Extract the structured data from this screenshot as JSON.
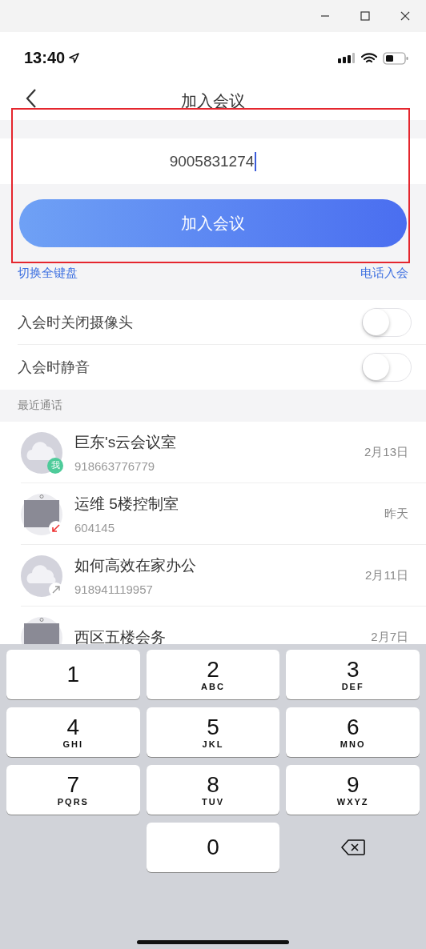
{
  "status_bar": {
    "time": "13:40"
  },
  "nav": {
    "title": "加入会议"
  },
  "meeting_id": {
    "value": "9005831274"
  },
  "join_button": {
    "label": "加入会议"
  },
  "links": {
    "left": "切换全键盘",
    "right": "电话入会"
  },
  "toggles": [
    {
      "label": "入会时关闭摄像头",
      "on": false
    },
    {
      "label": "入会时静音",
      "on": false
    }
  ],
  "recent": {
    "header": "最近通话",
    "items": [
      {
        "name": "巨东's云会议室",
        "number": "918663776779",
        "date": "2月13日",
        "avatar": {
          "kind": "cloud"
        },
        "badge": {
          "kind": "me",
          "text": "我"
        }
      },
      {
        "name": "运维 5楼控制室",
        "number": "604145",
        "date": "昨天",
        "avatar": {
          "kind": "monitor"
        },
        "badge": {
          "kind": "incoming"
        }
      },
      {
        "name": "如何高效在家办公",
        "number": "918941119957",
        "date": "2月11日",
        "avatar": {
          "kind": "cloud"
        },
        "badge": {
          "kind": "outgoing"
        }
      },
      {
        "name": "西区五楼会务",
        "date": "2月7日",
        "avatar": {
          "kind": "monitor"
        }
      }
    ]
  },
  "keypad": [
    {
      "kind": "digit",
      "digit": "1"
    },
    {
      "kind": "digit",
      "digit": "2",
      "letters": "ABC"
    },
    {
      "kind": "digit",
      "digit": "3",
      "letters": "DEF"
    },
    {
      "kind": "digit",
      "digit": "4",
      "letters": "GHI"
    },
    {
      "kind": "digit",
      "digit": "5",
      "letters": "JKL"
    },
    {
      "kind": "digit",
      "digit": "6",
      "letters": "MNO"
    },
    {
      "kind": "digit",
      "digit": "7",
      "letters": "PQRS"
    },
    {
      "kind": "digit",
      "digit": "8",
      "letters": "TUV"
    },
    {
      "kind": "digit",
      "digit": "9",
      "letters": "WXYZ"
    },
    {
      "kind": "blank"
    },
    {
      "kind": "digit",
      "digit": "0"
    },
    {
      "kind": "delete"
    }
  ]
}
